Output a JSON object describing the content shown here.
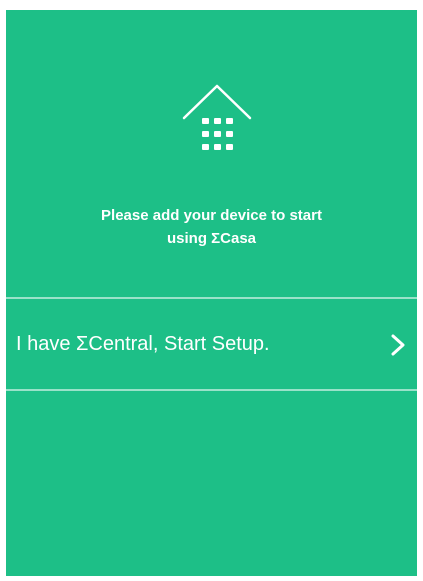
{
  "colors": {
    "accent": "#1dbf87",
    "foreground": "#ffffff"
  },
  "icons": {
    "hero": "house-keypad-icon",
    "setup_arrow": "chevron-right-icon"
  },
  "message": {
    "line1": "Please add your device to start",
    "line2": "using ΣCasa"
  },
  "setup": {
    "label": "I have ΣCentral, Start Setup."
  }
}
